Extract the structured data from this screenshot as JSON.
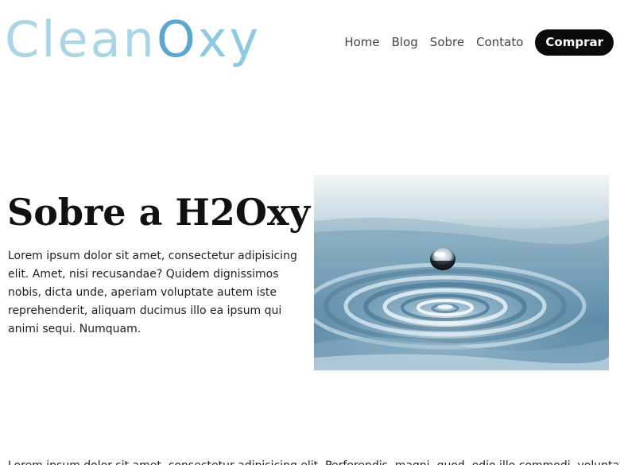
{
  "header": {
    "logo": {
      "part1": "Clean",
      "part2": "O",
      "part3": "xy"
    },
    "nav": {
      "items": [
        {
          "label": "Home"
        },
        {
          "label": "Blog"
        },
        {
          "label": "Sobre"
        },
        {
          "label": "Contato"
        }
      ],
      "buy_label": "Comprar"
    }
  },
  "about": {
    "title": "Sobre a H2Oxy",
    "text": "Lorem ipsum dolor sit amet, consectetur adipisicing elit. Amet, nisi recusandae? Quidem dignissimos nobis, dicta unde, aperiam voluptate autem iste reprehenderit, aliquam ducimus illo ea ipsum qui animi sequi. Numquam.",
    "image": {
      "subject": "water-drop-ripple-photo"
    }
  },
  "bottom": {
    "text": "Lorem ipsum dolor sit amet, consectetur adipisicing elit. Perferendis, magni, quod, odio illo commodi, voluptate"
  },
  "colors": {
    "logo_light": "#a9d6e6",
    "logo_accent": "#5aa7d2",
    "button_bg": "#0b0b0b",
    "button_text": "#ffffff",
    "nav_text": "#444444"
  }
}
